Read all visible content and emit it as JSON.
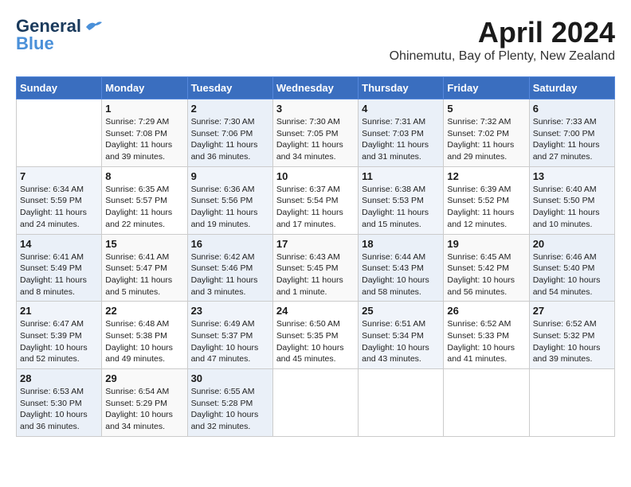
{
  "header": {
    "logo_line1": "General",
    "logo_line2": "Blue",
    "month": "April 2024",
    "location": "Ohinemutu, Bay of Plenty, New Zealand"
  },
  "days_of_week": [
    "Sunday",
    "Monday",
    "Tuesday",
    "Wednesday",
    "Thursday",
    "Friday",
    "Saturday"
  ],
  "weeks": [
    [
      {
        "num": "",
        "info": ""
      },
      {
        "num": "1",
        "info": "Sunrise: 7:29 AM\nSunset: 7:08 PM\nDaylight: 11 hours\nand 39 minutes."
      },
      {
        "num": "2",
        "info": "Sunrise: 7:30 AM\nSunset: 7:06 PM\nDaylight: 11 hours\nand 36 minutes."
      },
      {
        "num": "3",
        "info": "Sunrise: 7:30 AM\nSunset: 7:05 PM\nDaylight: 11 hours\nand 34 minutes."
      },
      {
        "num": "4",
        "info": "Sunrise: 7:31 AM\nSunset: 7:03 PM\nDaylight: 11 hours\nand 31 minutes."
      },
      {
        "num": "5",
        "info": "Sunrise: 7:32 AM\nSunset: 7:02 PM\nDaylight: 11 hours\nand 29 minutes."
      },
      {
        "num": "6",
        "info": "Sunrise: 7:33 AM\nSunset: 7:00 PM\nDaylight: 11 hours\nand 27 minutes."
      }
    ],
    [
      {
        "num": "7",
        "info": "Sunrise: 6:34 AM\nSunset: 5:59 PM\nDaylight: 11 hours\nand 24 minutes."
      },
      {
        "num": "8",
        "info": "Sunrise: 6:35 AM\nSunset: 5:57 PM\nDaylight: 11 hours\nand 22 minutes."
      },
      {
        "num": "9",
        "info": "Sunrise: 6:36 AM\nSunset: 5:56 PM\nDaylight: 11 hours\nand 19 minutes."
      },
      {
        "num": "10",
        "info": "Sunrise: 6:37 AM\nSunset: 5:54 PM\nDaylight: 11 hours\nand 17 minutes."
      },
      {
        "num": "11",
        "info": "Sunrise: 6:38 AM\nSunset: 5:53 PM\nDaylight: 11 hours\nand 15 minutes."
      },
      {
        "num": "12",
        "info": "Sunrise: 6:39 AM\nSunset: 5:52 PM\nDaylight: 11 hours\nand 12 minutes."
      },
      {
        "num": "13",
        "info": "Sunrise: 6:40 AM\nSunset: 5:50 PM\nDaylight: 11 hours\nand 10 minutes."
      }
    ],
    [
      {
        "num": "14",
        "info": "Sunrise: 6:41 AM\nSunset: 5:49 PM\nDaylight: 11 hours\nand 8 minutes."
      },
      {
        "num": "15",
        "info": "Sunrise: 6:41 AM\nSunset: 5:47 PM\nDaylight: 11 hours\nand 5 minutes."
      },
      {
        "num": "16",
        "info": "Sunrise: 6:42 AM\nSunset: 5:46 PM\nDaylight: 11 hours\nand 3 minutes."
      },
      {
        "num": "17",
        "info": "Sunrise: 6:43 AM\nSunset: 5:45 PM\nDaylight: 11 hours\nand 1 minute."
      },
      {
        "num": "18",
        "info": "Sunrise: 6:44 AM\nSunset: 5:43 PM\nDaylight: 10 hours\nand 58 minutes."
      },
      {
        "num": "19",
        "info": "Sunrise: 6:45 AM\nSunset: 5:42 PM\nDaylight: 10 hours\nand 56 minutes."
      },
      {
        "num": "20",
        "info": "Sunrise: 6:46 AM\nSunset: 5:40 PM\nDaylight: 10 hours\nand 54 minutes."
      }
    ],
    [
      {
        "num": "21",
        "info": "Sunrise: 6:47 AM\nSunset: 5:39 PM\nDaylight: 10 hours\nand 52 minutes."
      },
      {
        "num": "22",
        "info": "Sunrise: 6:48 AM\nSunset: 5:38 PM\nDaylight: 10 hours\nand 49 minutes."
      },
      {
        "num": "23",
        "info": "Sunrise: 6:49 AM\nSunset: 5:37 PM\nDaylight: 10 hours\nand 47 minutes."
      },
      {
        "num": "24",
        "info": "Sunrise: 6:50 AM\nSunset: 5:35 PM\nDaylight: 10 hours\nand 45 minutes."
      },
      {
        "num": "25",
        "info": "Sunrise: 6:51 AM\nSunset: 5:34 PM\nDaylight: 10 hours\nand 43 minutes."
      },
      {
        "num": "26",
        "info": "Sunrise: 6:52 AM\nSunset: 5:33 PM\nDaylight: 10 hours\nand 41 minutes."
      },
      {
        "num": "27",
        "info": "Sunrise: 6:52 AM\nSunset: 5:32 PM\nDaylight: 10 hours\nand 39 minutes."
      }
    ],
    [
      {
        "num": "28",
        "info": "Sunrise: 6:53 AM\nSunset: 5:30 PM\nDaylight: 10 hours\nand 36 minutes."
      },
      {
        "num": "29",
        "info": "Sunrise: 6:54 AM\nSunset: 5:29 PM\nDaylight: 10 hours\nand 34 minutes."
      },
      {
        "num": "30",
        "info": "Sunrise: 6:55 AM\nSunset: 5:28 PM\nDaylight: 10 hours\nand 32 minutes."
      },
      {
        "num": "",
        "info": ""
      },
      {
        "num": "",
        "info": ""
      },
      {
        "num": "",
        "info": ""
      },
      {
        "num": "",
        "info": ""
      }
    ]
  ]
}
